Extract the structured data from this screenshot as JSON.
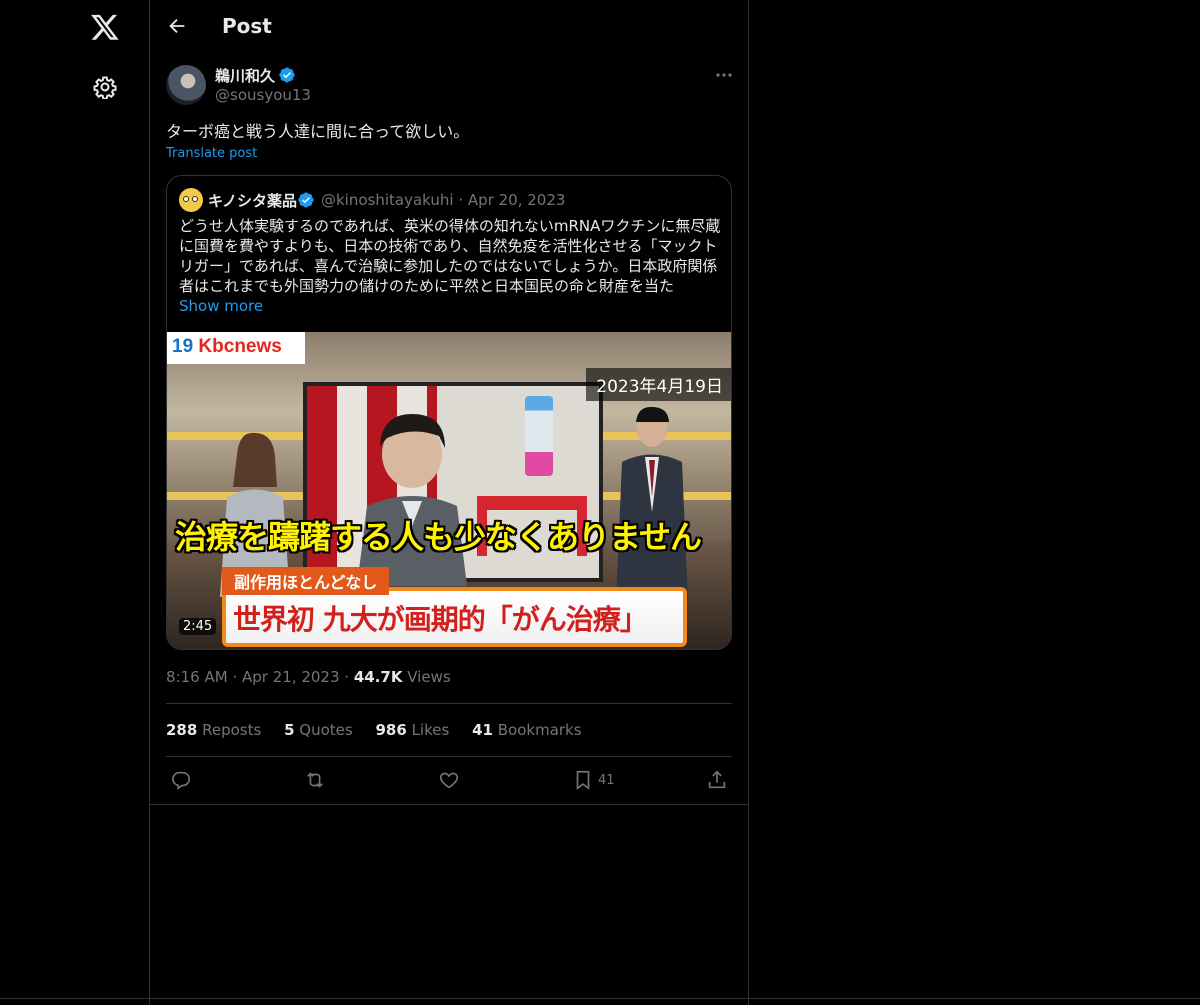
{
  "header": {
    "title": "Post"
  },
  "post": {
    "author_name": "鵜川和久",
    "author_handle": "@sousyou13",
    "text": "ターボ癌と戦う人達に間に合って欲しい。",
    "translate_label": "Translate post",
    "time": "8:16 AM",
    "date": "Apr 21, 2023",
    "views_count": "44.7K",
    "views_label": "Views"
  },
  "quote": {
    "author_name": "キノシタ薬品",
    "author_handle": "@kinoshitayakuhi",
    "date": "Apr 20, 2023",
    "text": "どうせ人体実験するのであれば、英米の得体の知れないmRNAワクチンに無尽蔵に国費を費やすよりも、日本の技術であり、自然免疫を活性化させる「マックトリガー」であれば、喜んで治験に参加したのではないでしょうか。日本政府関係者はこれまでも外国勢力の儲けのために平然と日本国民の命と財産を当た",
    "show_more": "Show more",
    "video": {
      "channel_logo": "Kbcnews",
      "channel_num": "19",
      "date_caption": "2023年4月19日",
      "subtitle": "治療を躊躇する人も少なくありません",
      "tag": "副作用ほとんどなし",
      "headline": "世界初 九大が画期的「がん治療」",
      "duration": "2:45"
    }
  },
  "stats": [
    {
      "count": "288",
      "label": "Reposts"
    },
    {
      "count": "5",
      "label": "Quotes"
    },
    {
      "count": "986",
      "label": "Likes"
    },
    {
      "count": "41",
      "label": "Bookmarks"
    }
  ],
  "actions": {
    "bookmark_count": "41"
  },
  "icons": [
    "x-logo-icon",
    "settings-icon",
    "back-arrow-icon",
    "verified-badge-icon",
    "more-icon",
    "reply-icon",
    "repost-icon",
    "like-icon",
    "bookmark-icon",
    "share-icon"
  ],
  "colors": {
    "accent": "#1d9bf0",
    "background": "#000000",
    "text": "#e7e9ea",
    "muted": "#71767b",
    "border": "#2f3336"
  }
}
